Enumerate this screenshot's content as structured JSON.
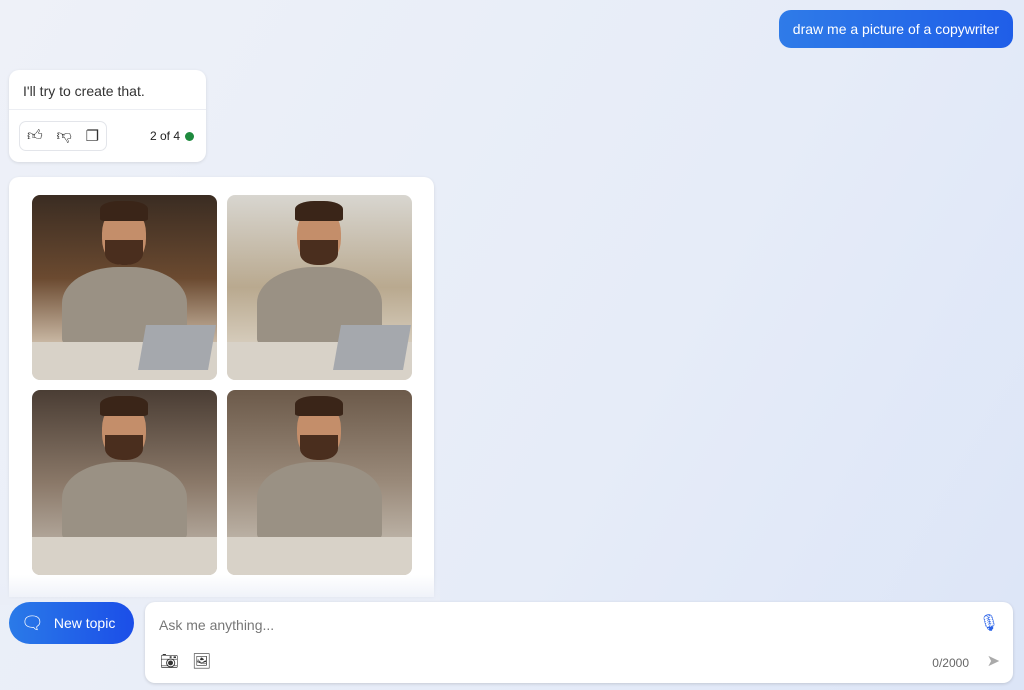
{
  "user_message": "draw me a picture of a copywriter",
  "bot": {
    "text": "I'll try to create that.",
    "actions": [
      {
        "icon": "thumbs-up-icon",
        "glyph": "👍"
      },
      {
        "icon": "thumbs-down-icon",
        "glyph": "👎"
      },
      {
        "icon": "copy-icon",
        "glyph": "❐"
      }
    ],
    "response_count": "2 of 4",
    "status_color": "#1e8a3e"
  },
  "images": [
    {
      "alt": "copywriter image 1"
    },
    {
      "alt": "copywriter image 2"
    },
    {
      "alt": "copywriter image 3"
    },
    {
      "alt": "copywriter image 4"
    }
  ],
  "composer": {
    "new_topic_label": "New topic",
    "placeholder": "Ask me anything...",
    "char_count": "0/2000"
  },
  "colors": {
    "accent": "#1f5ee8"
  }
}
